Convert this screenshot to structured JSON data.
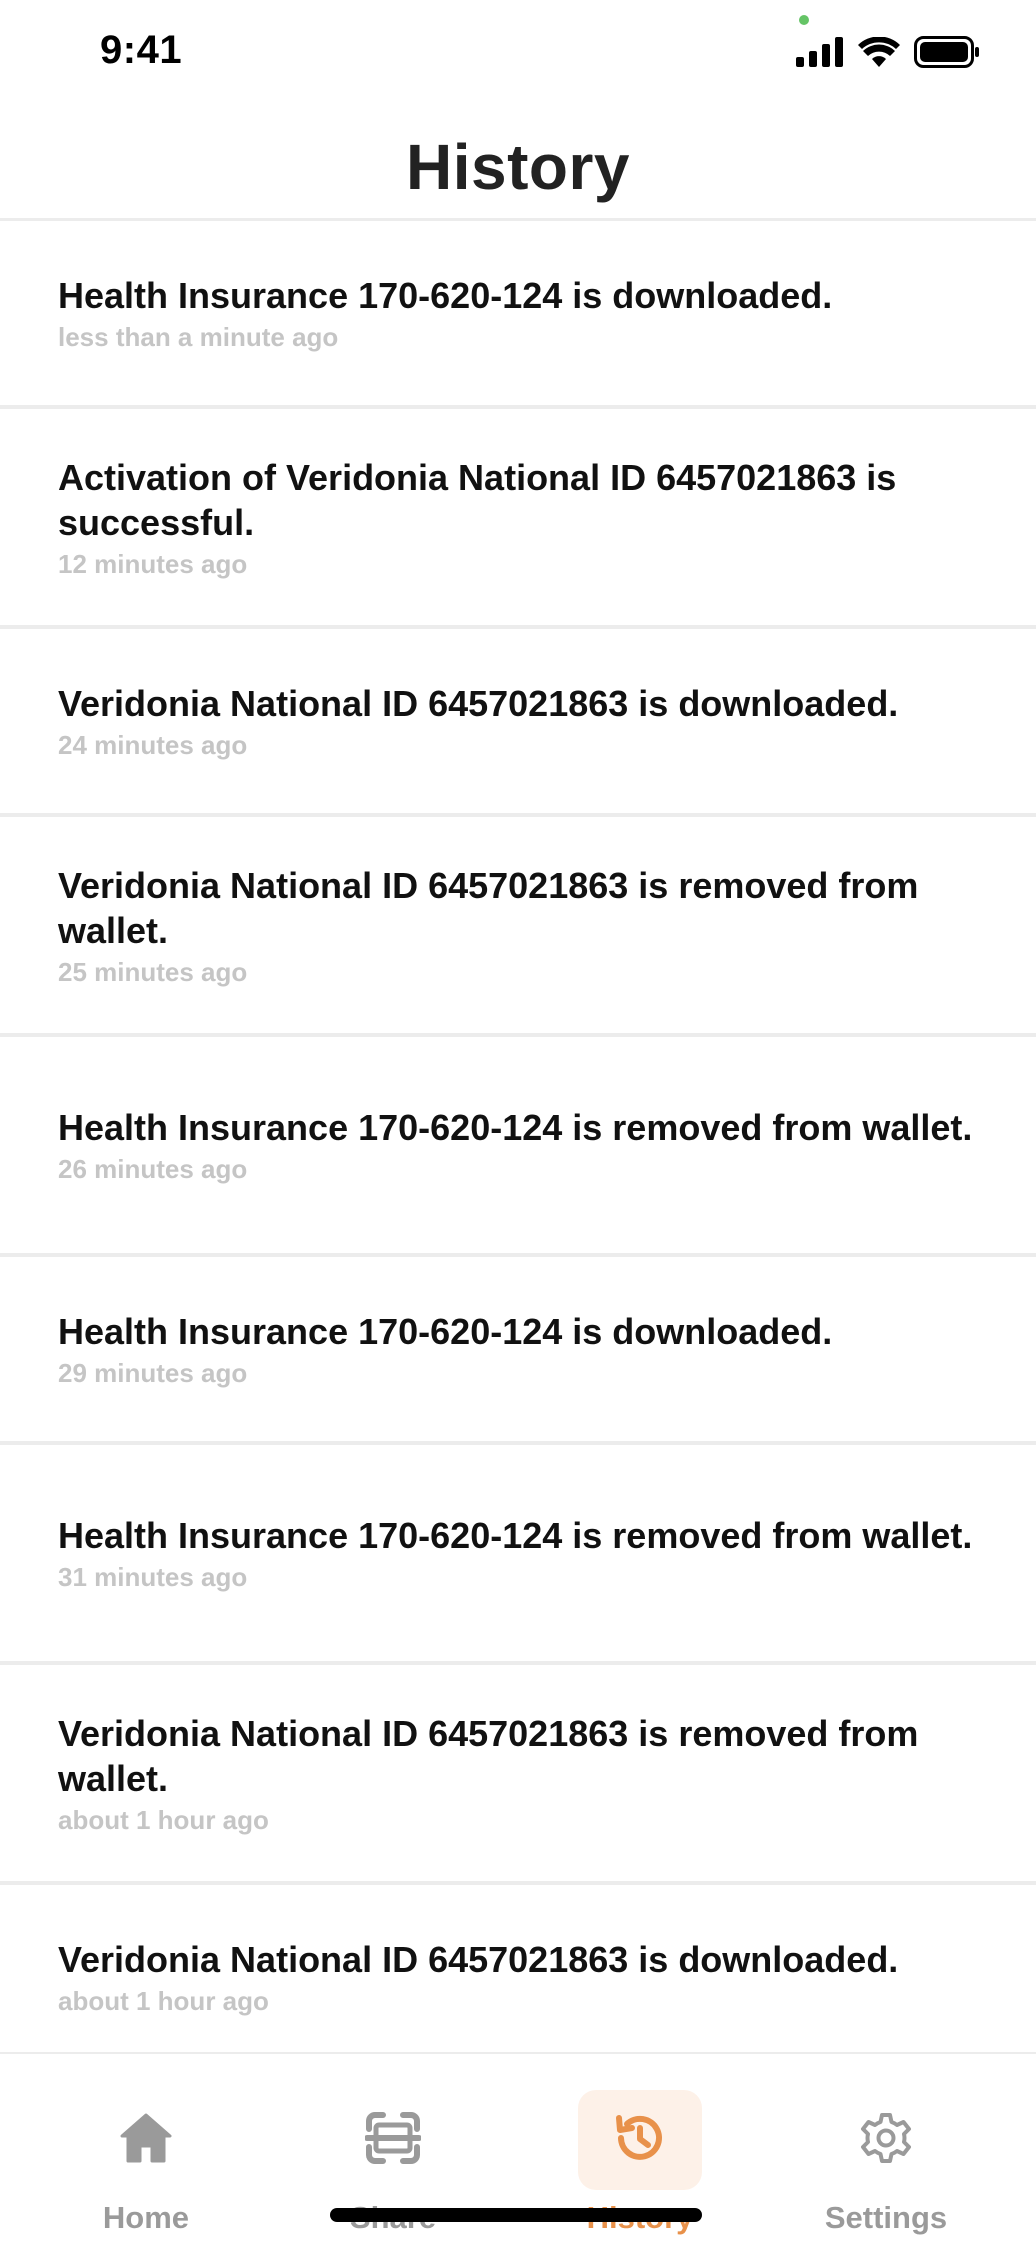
{
  "status_bar": {
    "time": "9:41"
  },
  "header": {
    "title": "History"
  },
  "history": [
    {
      "text": "Health Insurance 170-620-124 is downloaded.",
      "time": "less than a minute ago"
    },
    {
      "text": "Activation of Veridonia National ID 6457021863 is successful.",
      "time": "12 minutes ago"
    },
    {
      "text": "Veridonia National ID 6457021863 is downloaded.",
      "time": "24 minutes ago"
    },
    {
      "text": "Veridonia National ID 6457021863 is removed from wallet.",
      "time": "25 minutes ago"
    },
    {
      "text": "Health Insurance 170-620-124 is removed from wallet.",
      "time": "26 minutes ago"
    },
    {
      "text": "Health Insurance 170-620-124 is downloaded.",
      "time": "29 minutes ago"
    },
    {
      "text": "Health Insurance 170-620-124 is removed from wallet.",
      "time": "31 minutes ago"
    },
    {
      "text": "Veridonia National ID 6457021863 is removed from wallet.",
      "time": "about 1 hour ago"
    },
    {
      "text": "Veridonia National ID 6457021863 is downloaded.",
      "time": "about 1 hour ago"
    }
  ],
  "tabs": [
    {
      "label": "Home",
      "icon": "home-icon",
      "active": false
    },
    {
      "label": "Share",
      "icon": "scan-icon",
      "active": false
    },
    {
      "label": "History",
      "icon": "history-icon",
      "active": true
    },
    {
      "label": "Settings",
      "icon": "gear-icon",
      "active": false
    }
  ],
  "colors": {
    "accent": "#e8914a",
    "accent_bg": "#fdf1e8",
    "inactive": "#9a9a9a",
    "timestamp": "#c5c5c5"
  }
}
